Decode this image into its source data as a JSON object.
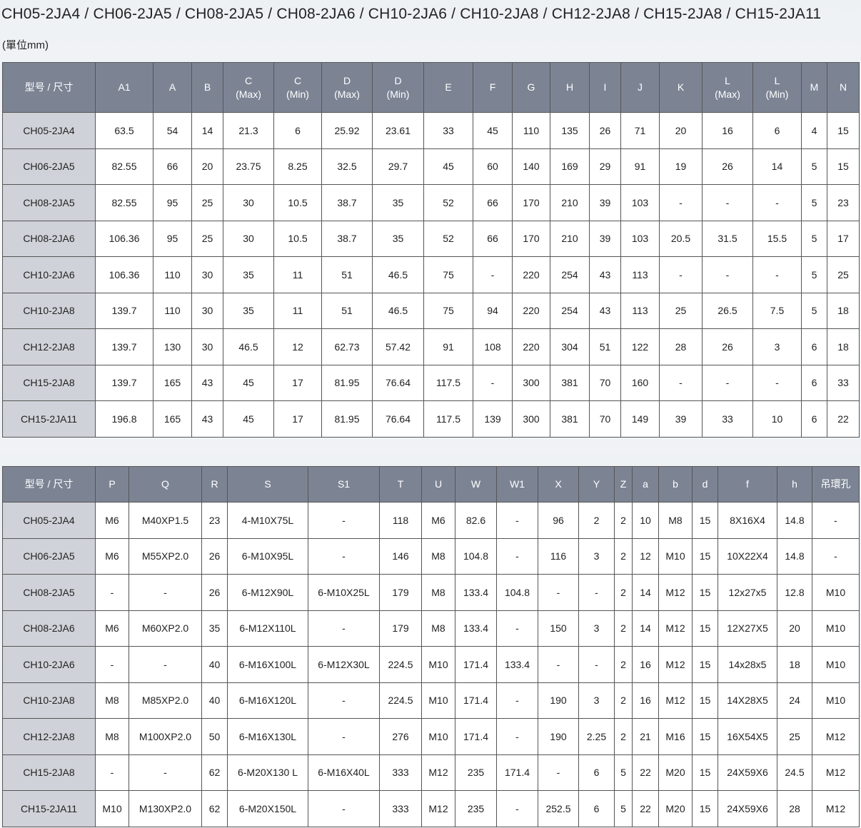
{
  "title": "CH05-2JA4 / CH06-2JA5 / CH08-2JA5 / CH08-2JA6 / CH10-2JA6 / CH10-2JA8 / CH12-2JA8 / CH15-2JA8 / CH15-2JA11",
  "unit": "(單位mm)",
  "table1": {
    "headers": [
      [
        "型号 / 尺寸"
      ],
      [
        "A1"
      ],
      [
        "A"
      ],
      [
        "B"
      ],
      [
        "C",
        "(Max)"
      ],
      [
        "C",
        "(Min)"
      ],
      [
        "D",
        "(Max)"
      ],
      [
        "D",
        "(Min)"
      ],
      [
        "E"
      ],
      [
        "F"
      ],
      [
        "G"
      ],
      [
        "H"
      ],
      [
        "I"
      ],
      [
        "J"
      ],
      [
        "K"
      ],
      [
        "L",
        "(Max)"
      ],
      [
        "L",
        "(Min)"
      ],
      [
        "M"
      ],
      [
        "N"
      ]
    ],
    "rows": [
      [
        "CH05-2JA4",
        "63.5",
        "54",
        "14",
        "21.3",
        "6",
        "25.92",
        "23.61",
        "33",
        "45",
        "110",
        "135",
        "26",
        "71",
        "20",
        "16",
        "6",
        "4",
        "15"
      ],
      [
        "CH06-2JA5",
        "82.55",
        "66",
        "20",
        "23.75",
        "8.25",
        "32.5",
        "29.7",
        "45",
        "60",
        "140",
        "169",
        "29",
        "91",
        "19",
        "26",
        "14",
        "5",
        "15"
      ],
      [
        "CH08-2JA5",
        "82.55",
        "95",
        "25",
        "30",
        "10.5",
        "38.7",
        "35",
        "52",
        "66",
        "170",
        "210",
        "39",
        "103",
        "-",
        "-",
        "-",
        "5",
        "23"
      ],
      [
        "CH08-2JA6",
        "106.36",
        "95",
        "25",
        "30",
        "10.5",
        "38.7",
        "35",
        "52",
        "66",
        "170",
        "210",
        "39",
        "103",
        "20.5",
        "31.5",
        "15.5",
        "5",
        "17"
      ],
      [
        "CH10-2JA6",
        "106.36",
        "110",
        "30",
        "35",
        "11",
        "51",
        "46.5",
        "75",
        "-",
        "220",
        "254",
        "43",
        "113",
        "-",
        "-",
        "-",
        "5",
        "25"
      ],
      [
        "CH10-2JA8",
        "139.7",
        "110",
        "30",
        "35",
        "11",
        "51",
        "46.5",
        "75",
        "94",
        "220",
        "254",
        "43",
        "113",
        "25",
        "26.5",
        "7.5",
        "5",
        "18"
      ],
      [
        "CH12-2JA8",
        "139.7",
        "130",
        "30",
        "46.5",
        "12",
        "62.73",
        "57.42",
        "91",
        "108",
        "220",
        "304",
        "51",
        "122",
        "28",
        "26",
        "3",
        "6",
        "18"
      ],
      [
        "CH15-2JA8",
        "139.7",
        "165",
        "43",
        "45",
        "17",
        "81.95",
        "76.64",
        "117.5",
        "-",
        "300",
        "381",
        "70",
        "160",
        "-",
        "-",
        "-",
        "6",
        "33"
      ],
      [
        "CH15-2JA11",
        "196.8",
        "165",
        "43",
        "45",
        "17",
        "81.95",
        "76.64",
        "117.5",
        "139",
        "300",
        "381",
        "70",
        "149",
        "39",
        "33",
        "10",
        "6",
        "22"
      ]
    ]
  },
  "table2": {
    "headers": [
      [
        "型号 / 尺寸"
      ],
      [
        "P"
      ],
      [
        "Q"
      ],
      [
        "R"
      ],
      [
        "S"
      ],
      [
        "S1"
      ],
      [
        "T"
      ],
      [
        "U"
      ],
      [
        "W"
      ],
      [
        "W1"
      ],
      [
        "X"
      ],
      [
        "Y"
      ],
      [
        "Z"
      ],
      [
        "a"
      ],
      [
        "b"
      ],
      [
        "d"
      ],
      [
        "f"
      ],
      [
        "h"
      ],
      [
        "吊環孔"
      ]
    ],
    "rows": [
      [
        "CH05-2JA4",
        "M6",
        "M40XP1.5",
        "23",
        "4-M10X75L",
        "-",
        "118",
        "M6",
        "82.6",
        "-",
        "96",
        "2",
        "2",
        "10",
        "M8",
        "15",
        "8X16X4",
        "14.8",
        "-"
      ],
      [
        "CH06-2JA5",
        "M6",
        "M55XP2.0",
        "26",
        "6-M10X95L",
        "-",
        "146",
        "M8",
        "104.8",
        "-",
        "116",
        "3",
        "2",
        "12",
        "M10",
        "15",
        "10X22X4",
        "14.8",
        "-"
      ],
      [
        "CH08-2JA5",
        "-",
        "-",
        "26",
        "6-M12X90L",
        "6-M10X25L",
        "179",
        "M8",
        "133.4",
        "104.8",
        "-",
        "-",
        "2",
        "14",
        "M12",
        "15",
        "12x27x5",
        "12.8",
        "M10"
      ],
      [
        "CH08-2JA6",
        "M6",
        "M60XP2.0",
        "35",
        "6-M12X110L",
        "-",
        "179",
        "M8",
        "133.4",
        "-",
        "150",
        "3",
        "2",
        "14",
        "M12",
        "15",
        "12X27X5",
        "20",
        "M10"
      ],
      [
        "CH10-2JA6",
        "-",
        "-",
        "40",
        "6-M16X100L",
        "6-M12X30L",
        "224.5",
        "M10",
        "171.4",
        "133.4",
        "-",
        "-",
        "2",
        "16",
        "M12",
        "15",
        "14x28x5",
        "18",
        "M10"
      ],
      [
        "CH10-2JA8",
        "M8",
        "M85XP2.0",
        "40",
        "6-M16X120L",
        "-",
        "224.5",
        "M10",
        "171.4",
        "-",
        "190",
        "3",
        "2",
        "16",
        "M12",
        "15",
        "14X28X5",
        "24",
        "M10"
      ],
      [
        "CH12-2JA8",
        "M8",
        "M100XP2.0",
        "50",
        "6-M16X130L",
        "-",
        "276",
        "M10",
        "171.4",
        "-",
        "190",
        "2.25",
        "2",
        "21",
        "M16",
        "15",
        "16X54X5",
        "25",
        "M12"
      ],
      [
        "CH15-2JA8",
        "-",
        "-",
        "62",
        "6-M20X130 L",
        "6-M16X40L",
        "333",
        "M12",
        "235",
        "171.4",
        "-",
        "6",
        "5",
        "22",
        "M20",
        "15",
        "24X59X6",
        "24.5",
        "M12"
      ],
      [
        "CH15-2JA11",
        "M10",
        "M130XP2.0",
        "62",
        "6-M20X150L",
        "-",
        "333",
        "M12",
        "235",
        "-",
        "252.5",
        "6",
        "5",
        "22",
        "M20",
        "15",
        "24X59X6",
        "28",
        "M12"
      ]
    ]
  }
}
